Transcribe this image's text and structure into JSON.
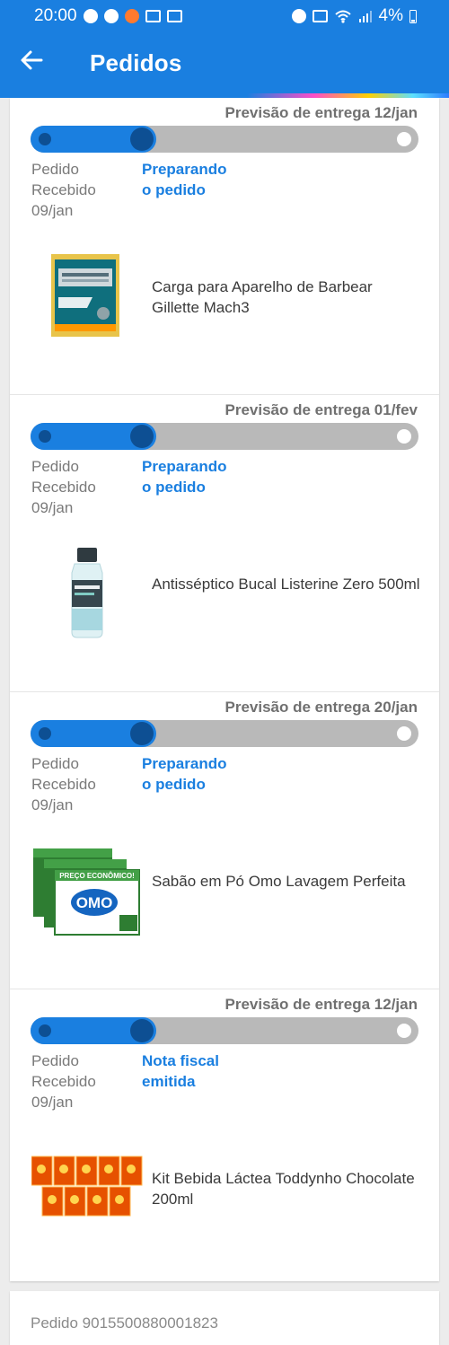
{
  "statusbar": {
    "time": "20:00",
    "battery": "4%"
  },
  "appbar": {
    "back_icon": "arrow-left-icon",
    "title": "Pedidos"
  },
  "orders": [
    {
      "forecast": "Previsão de entrega 12/jan",
      "stage1_line1": "Pedido",
      "stage1_line2": "Recebido",
      "stage1_date": "09/jan",
      "stage2_line1": "Preparando",
      "stage2_line2": "o pedido",
      "progress_steps_done": 2,
      "product": {
        "name": "Carga para Aparelho de Barbear Gillette Mach3",
        "image": "gillette-mach3-blade-pack"
      }
    },
    {
      "forecast": "Previsão de entrega 01/fev",
      "stage1_line1": "Pedido",
      "stage1_line2": "Recebido",
      "stage1_date": "09/jan",
      "stage2_line1": "Preparando",
      "stage2_line2": "o pedido",
      "progress_steps_done": 2,
      "product": {
        "name": "Antisséptico Bucal Listerine Zero 500ml",
        "image": "listerine-bottle"
      }
    },
    {
      "forecast": "Previsão de entrega 20/jan",
      "stage1_line1": "Pedido",
      "stage1_line2": "Recebido",
      "stage1_date": "09/jan",
      "stage2_line1": "Preparando",
      "stage2_line2": "o pedido",
      "progress_steps_done": 2,
      "product": {
        "name": "Sabão em Pó Omo Lavagem Perfeita",
        "image": "omo-detergent-boxes",
        "image_text": "PREÇO ECONÔMICO!"
      }
    },
    {
      "forecast": "Previsão de entrega 12/jan",
      "stage1_line1": "Pedido",
      "stage1_line2": "Recebido",
      "stage1_date": "09/jan",
      "stage2_line1": "Nota fiscal",
      "stage2_line2": "emitida",
      "progress_steps_done": 2,
      "product": {
        "name": "Kit Bebida Láctea Toddynho Chocolate 200ml",
        "image": "toddynho-boxes"
      }
    }
  ],
  "next_order": {
    "number": "Pedido 9015500880001823"
  },
  "colors": {
    "primary": "#1a7fe0",
    "track": "#b9b9b9",
    "dark_dot": "#0d4f93"
  }
}
